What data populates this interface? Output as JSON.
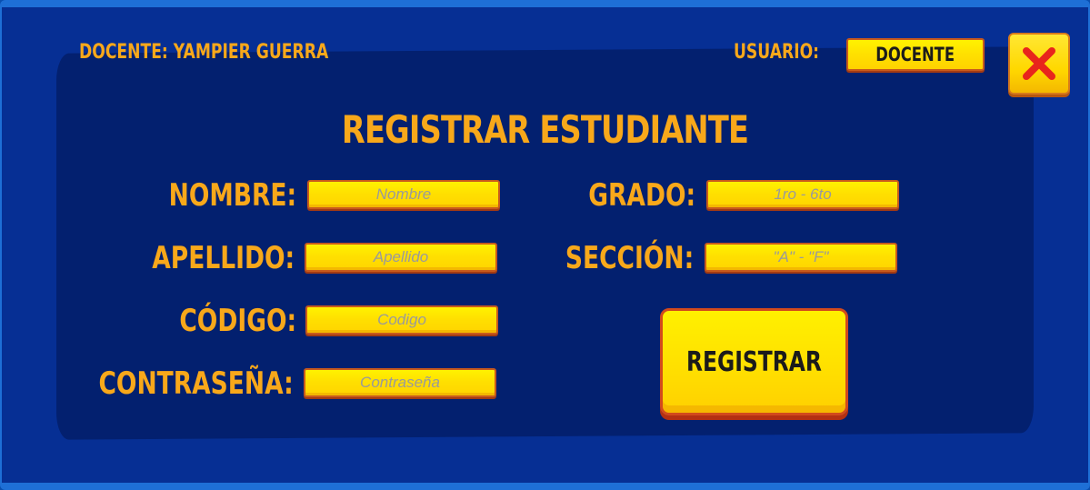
{
  "header": {
    "teacher_text": "DOCENTE: YAMPIER GUERRA",
    "user_label": "USUARIO:",
    "user_value": "DOCENTE",
    "close_icon": "close-x-icon"
  },
  "form": {
    "title": "REGISTRAR ESTUDIANTE",
    "fields": {
      "nombre": {
        "label": "NOMBRE:",
        "placeholder": "Nombre"
      },
      "apellido": {
        "label": "APELLIDO:",
        "placeholder": "Apellido"
      },
      "codigo": {
        "label": "CÓDIGO:",
        "placeholder": "Codigo"
      },
      "contrasena": {
        "label": "CONTRASEÑA:",
        "placeholder": "Contraseña"
      },
      "grado": {
        "label": "GRADO:",
        "placeholder": "1ro - 6to"
      },
      "seccion": {
        "label": "SECCIÓN:",
        "placeholder": "\"A\" - \"F\""
      }
    },
    "submit_label": "REGISTRAR"
  },
  "colors": {
    "accent_orange": "#f8a81a",
    "button_yellow": "#ffe000",
    "panel_blue": "#03206f",
    "close_red": "#e8251c"
  }
}
